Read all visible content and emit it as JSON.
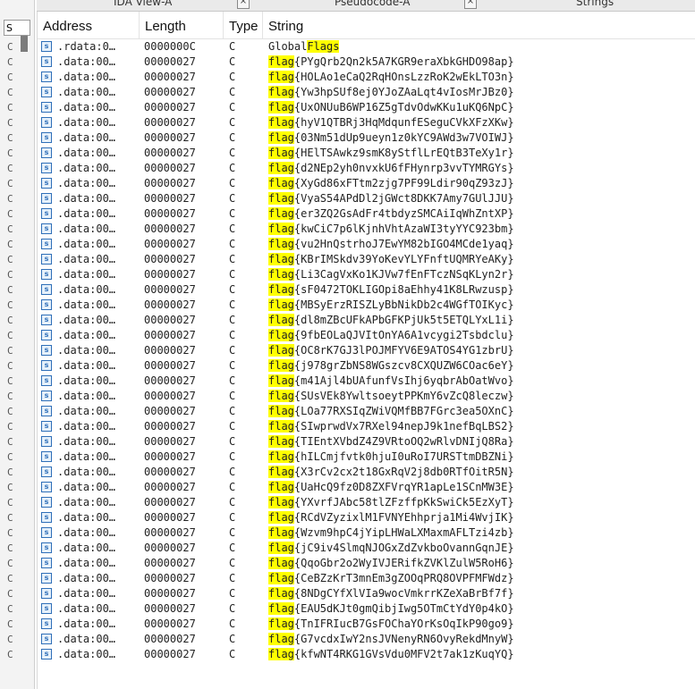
{
  "tabs": [
    {
      "label": "IDA View-A"
    },
    {
      "label": "Pseudocode-A"
    },
    {
      "label": "Strings"
    }
  ],
  "left_pane": {
    "column_label": "S",
    "letters": [
      "C",
      "C",
      "C",
      "C",
      "C",
      "C",
      "C",
      "C",
      "C",
      "C",
      "C",
      "C",
      "C",
      "C",
      "C",
      "C",
      "C",
      "C",
      "C",
      "C",
      "C",
      "C",
      "C",
      "C",
      "C",
      "C",
      "C",
      "C",
      "C",
      "C",
      "C",
      "C",
      "C",
      "C",
      "C",
      "C",
      "C",
      "C",
      "C",
      "C",
      "C"
    ]
  },
  "table": {
    "columns": [
      "Address",
      "Length",
      "Type",
      "String"
    ],
    "highlight_color": "#ffff00",
    "highlight_term": "flag",
    "rows": [
      {
        "address": ".rdata:0…",
        "length": "0000000C",
        "type": "C",
        "prefix": "Global",
        "highlight": "Flags",
        "rest": ""
      },
      {
        "address": ".data:00…",
        "length": "00000027",
        "type": "C",
        "prefix": "",
        "highlight": "flag",
        "rest": "{PYgQrb2Qn2k5A7KGR9eraXbkGHDO98ap}"
      },
      {
        "address": ".data:00…",
        "length": "00000027",
        "type": "C",
        "prefix": "",
        "highlight": "flag",
        "rest": "{HOLAo1eCaQ2RqHOnsLzzRoK2wEkLTO3n}"
      },
      {
        "address": ".data:00…",
        "length": "00000027",
        "type": "C",
        "prefix": "",
        "highlight": "flag",
        "rest": "{Yw3hpSUf8ej0YJoZAaLqt4vIosMrJBz0}"
      },
      {
        "address": ".data:00…",
        "length": "00000027",
        "type": "C",
        "prefix": "",
        "highlight": "flag",
        "rest": "{UxONUuB6WP16Z5gTdvOdwKKu1uKQ6NpC}"
      },
      {
        "address": ".data:00…",
        "length": "00000027",
        "type": "C",
        "prefix": "",
        "highlight": "flag",
        "rest": "{hyV1QTBRj3HqMdqunfESeguCVkXFzXKw}"
      },
      {
        "address": ".data:00…",
        "length": "00000027",
        "type": "C",
        "prefix": "",
        "highlight": "flag",
        "rest": "{03Nm51dUp9ueyn1z0kYC9AWd3w7VOIWJ}"
      },
      {
        "address": ".data:00…",
        "length": "00000027",
        "type": "C",
        "prefix": "",
        "highlight": "flag",
        "rest": "{HElTSAwkz9smK8yStflLrEQtB3TeXy1r}"
      },
      {
        "address": ".data:00…",
        "length": "00000027",
        "type": "C",
        "prefix": "",
        "highlight": "flag",
        "rest": "{d2NEp2yh0nvxkU6fFHynrp3vvTYMRGYs}"
      },
      {
        "address": ".data:00…",
        "length": "00000027",
        "type": "C",
        "prefix": "",
        "highlight": "flag",
        "rest": "{XyGd86xFTtm2zjg7PF99Ldir90qZ93zJ}"
      },
      {
        "address": ".data:00…",
        "length": "00000027",
        "type": "C",
        "prefix": "",
        "highlight": "flag",
        "rest": "{VyaS54APdDl2jGWct8DKK7Amy7GUlJJU}"
      },
      {
        "address": ".data:00…",
        "length": "00000027",
        "type": "C",
        "prefix": "",
        "highlight": "flag",
        "rest": "{er3ZQ2GsAdFr4tbdyzSMCAiIqWhZntXP}"
      },
      {
        "address": ".data:00…",
        "length": "00000027",
        "type": "C",
        "prefix": "",
        "highlight": "flag",
        "rest": "{kwCiC7p6lKjnhVhtAzaWI3tyYYC923bm}"
      },
      {
        "address": ".data:00…",
        "length": "00000027",
        "type": "C",
        "prefix": "",
        "highlight": "flag",
        "rest": "{vu2HnQstrhoJ7EwYM82bIGO4MCde1yaq}"
      },
      {
        "address": ".data:00…",
        "length": "00000027",
        "type": "C",
        "prefix": "",
        "highlight": "flag",
        "rest": "{KBrIMSkdv39YoKevYLYFnftUQMRYeAKy}"
      },
      {
        "address": ".data:00…",
        "length": "00000027",
        "type": "C",
        "prefix": "",
        "highlight": "flag",
        "rest": "{Li3CagVxKo1KJVw7fEnFTczNSqKLyn2r}"
      },
      {
        "address": ".data:00…",
        "length": "00000027",
        "type": "C",
        "prefix": "",
        "highlight": "flag",
        "rest": "{sF0472TOKLIGOpi8aEhhy41K8LRwzusp}"
      },
      {
        "address": ".data:00…",
        "length": "00000027",
        "type": "C",
        "prefix": "",
        "highlight": "flag",
        "rest": "{MBSyErzRISZLyBbNikDb2c4WGfTOIKyc}"
      },
      {
        "address": ".data:00…",
        "length": "00000027",
        "type": "C",
        "prefix": "",
        "highlight": "flag",
        "rest": "{dl8mZBcUFkAPbGFKPjUk5t5ETQLYxL1i}"
      },
      {
        "address": ".data:00…",
        "length": "00000027",
        "type": "C",
        "prefix": "",
        "highlight": "flag",
        "rest": "{9fbEOLaQJVItOnYA6A1vcygi2Tsbdclu}"
      },
      {
        "address": ".data:00…",
        "length": "00000027",
        "type": "C",
        "prefix": "",
        "highlight": "flag",
        "rest": "{OC8rK7GJ3lPOJMFYV6E9ATOS4YG1zbrU}"
      },
      {
        "address": ".data:00…",
        "length": "00000027",
        "type": "C",
        "prefix": "",
        "highlight": "flag",
        "rest": "{j978grZbNS8WGszcv8CXQUZW6COac6eY}"
      },
      {
        "address": ".data:00…",
        "length": "00000027",
        "type": "C",
        "prefix": "",
        "highlight": "flag",
        "rest": "{m41Ajl4bUAfunfVsIhj6yqbrAbOatWvo}"
      },
      {
        "address": ".data:00…",
        "length": "00000027",
        "type": "C",
        "prefix": "",
        "highlight": "flag",
        "rest": "{SUsVEk8YwltsoeytPPKmY6vZcQ8leczw}"
      },
      {
        "address": ".data:00…",
        "length": "00000027",
        "type": "C",
        "prefix": "",
        "highlight": "flag",
        "rest": "{LOa77RXSIqZWiVQMfBB7FGrc3ea5OXnC}"
      },
      {
        "address": ".data:00…",
        "length": "00000027",
        "type": "C",
        "prefix": "",
        "highlight": "flag",
        "rest": "{SIwprwdVx7RXel94nepJ9k1nefBqLBS2}"
      },
      {
        "address": ".data:00…",
        "length": "00000027",
        "type": "C",
        "prefix": "",
        "highlight": "flag",
        "rest": "{TIEntXVbdZ4Z9VRtoOQ2wRlvDNIjQ8Ra}"
      },
      {
        "address": ".data:00…",
        "length": "00000027",
        "type": "C",
        "prefix": "",
        "highlight": "flag",
        "rest": "{hILCmjfvtk0hjuI0uRoI7URSTtmDBZNi}"
      },
      {
        "address": ".data:00…",
        "length": "00000027",
        "type": "C",
        "prefix": "",
        "highlight": "flag",
        "rest": "{X3rCv2cx2t18GxRqV2j8db0RTfOitR5N}"
      },
      {
        "address": ".data:00…",
        "length": "00000027",
        "type": "C",
        "prefix": "",
        "highlight": "flag",
        "rest": "{UaHcQ9fz0D8ZXFVrqYR1apLe1SCnMW3E}"
      },
      {
        "address": ".data:00…",
        "length": "00000027",
        "type": "C",
        "prefix": "",
        "highlight": "flag",
        "rest": "{YXvrfJAbc58tlZFzffpKkSwiCk5EzXyT}"
      },
      {
        "address": ".data:00…",
        "length": "00000027",
        "type": "C",
        "prefix": "",
        "highlight": "flag",
        "rest": "{RCdVZyzixlM1FVNYEhhprja1Mi4WvjIK}"
      },
      {
        "address": ".data:00…",
        "length": "00000027",
        "type": "C",
        "prefix": "",
        "highlight": "flag",
        "rest": "{Wzvm9hpC4jYipLHWaLXMaxmAFLTzi4zb}"
      },
      {
        "address": ".data:00…",
        "length": "00000027",
        "type": "C",
        "prefix": "",
        "highlight": "flag",
        "rest": "{jC9iv4SlmqNJOGxZdZvkboOvannGqnJE}"
      },
      {
        "address": ".data:00…",
        "length": "00000027",
        "type": "C",
        "prefix": "",
        "highlight": "flag",
        "rest": "{QqoGbr2o2WyIVJERifkZVKlZulW5RoH6}"
      },
      {
        "address": ".data:00…",
        "length": "00000027",
        "type": "C",
        "prefix": "",
        "highlight": "flag",
        "rest": "{CeBZzKrT3mnEm3gZOOqPRQ8OVPFMFWdz}"
      },
      {
        "address": ".data:00…",
        "length": "00000027",
        "type": "C",
        "prefix": "",
        "highlight": "flag",
        "rest": "{8NDgCYfXlVIa9wocVmkrrKZeXaBrBf7f}"
      },
      {
        "address": ".data:00…",
        "length": "00000027",
        "type": "C",
        "prefix": "",
        "highlight": "flag",
        "rest": "{EAU5dKJt0gmQibjIwg5OTmCtYdY0p4kO}"
      },
      {
        "address": ".data:00…",
        "length": "00000027",
        "type": "C",
        "prefix": "",
        "highlight": "flag",
        "rest": "{TnIFRIucB7GsFOChaYOrKsOqIkP90go9}"
      },
      {
        "address": ".data:00…",
        "length": "00000027",
        "type": "C",
        "prefix": "",
        "highlight": "flag",
        "rest": "{G7vcdxIwY2nsJVNenyRN6OvyRekdMnyW}"
      },
      {
        "address": ".data:00…",
        "length": "00000027",
        "type": "C",
        "prefix": "",
        "highlight": "flag",
        "rest": "{kfwNT4RKG1GVsVdu0MFV2t7ak1zKuqYQ}"
      }
    ]
  }
}
